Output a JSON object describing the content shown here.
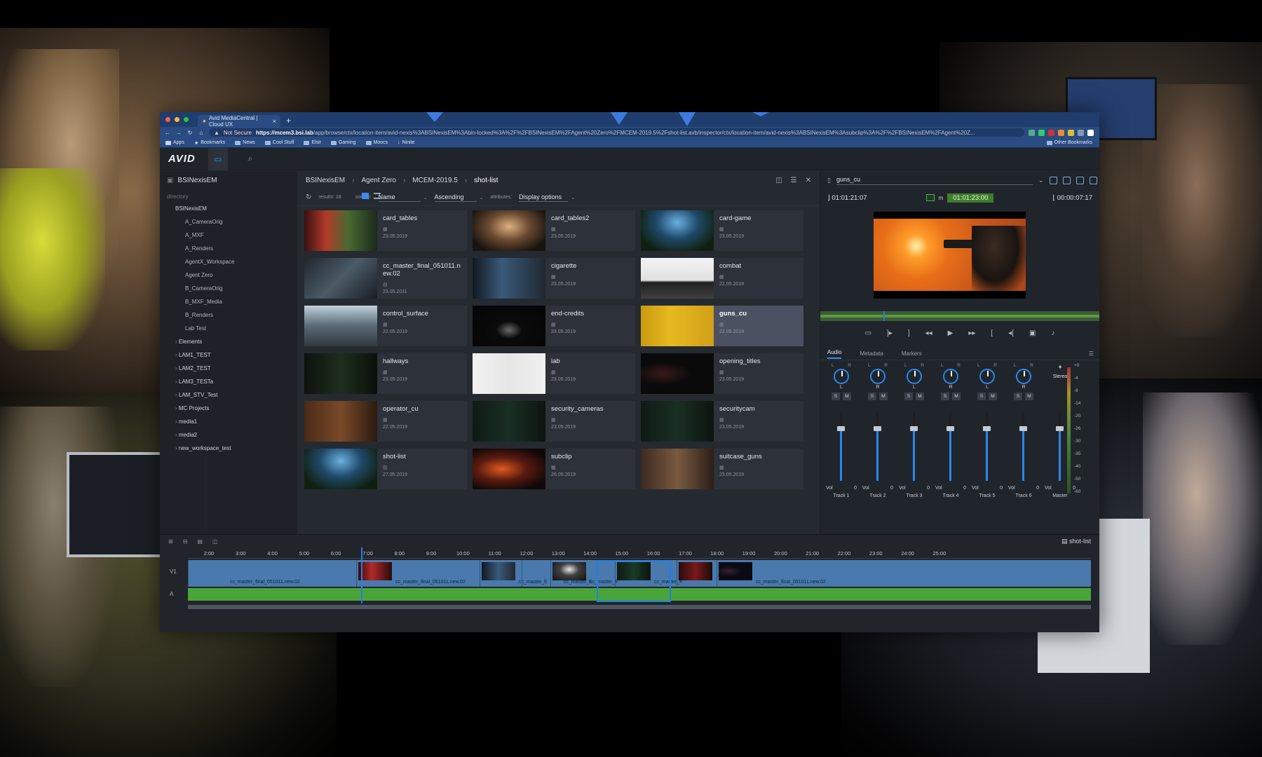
{
  "colors": {
    "accent": "#3a8df0",
    "browser_chrome": "#2a4c82",
    "timecode_green": "#3f7d2c",
    "clip_video": "#4a79ad",
    "clip_audio": "#49a43a",
    "selected_card": "#4b5161"
  },
  "browser": {
    "tab_title": "Avid MediaCentral | Cloud UX",
    "new_tab": "+",
    "not_secure": "Not Secure",
    "url_host": "https://mcem3.bsi.lab",
    "url_path": "/app/browse/ctx/location-item/avid-nexis%3ABSINexisEM%3Abin-locked%3A%2F%2FBSINexisEM%2FAgent%20Zero%2FMCEM-2019.5%2Fshot-list.avb/inspector/ctx/location-item/avid-nexis%3ABSINexisEM%3Asubclip%3A%2F%2FBSINexisEM%2FAgent%20Z...",
    "bookmarks": [
      "Apps",
      "Bookmarks",
      "News",
      "Cool Stuff",
      "Elsir",
      "Gaming",
      "Moocs",
      "Ninite"
    ],
    "other_bookmarks": "Other Bookmarks"
  },
  "app": {
    "logo": "AVID",
    "sidebar": {
      "root": "BSINexisEM",
      "label": "directory",
      "items_sub": [
        "BSINexisEM",
        "A_CameraOrig",
        "A_MXF",
        "A_Renders",
        "AgentX_Workspace",
        "Agent Zero",
        "B_CameraOrig",
        "B_MXF_Media",
        "B_Renders",
        "Lab Test"
      ],
      "items_top": [
        "Elements",
        "LAM1_TEST",
        "LAM2_TEST",
        "LAM3_TESTa",
        "LAM_STV_Test",
        "MC Projects",
        "media1",
        "media2",
        "new_workspace_test"
      ]
    },
    "browse": {
      "crumbs": [
        "BSINexisEM",
        "Agent Zero",
        "MCEM-2019.5",
        "shot-list"
      ],
      "results": "results: 18",
      "sort_label": "sort by:",
      "sort_value": "Name",
      "order_value": "Ascending",
      "attributes_label": "attributes:",
      "attributes_value": "Display options",
      "items": [
        {
          "name": "card_tables",
          "date": "23.05.2019",
          "icon": "clip-icon"
        },
        {
          "name": "card_tables2",
          "date": "23.05.2019",
          "icon": "clip-icon"
        },
        {
          "name": "card-game",
          "date": "23.05.2019",
          "icon": "clip-icon"
        },
        {
          "name": "cc_master_final_051011.new.02",
          "date": "23.05.2011",
          "icon": "sequence-icon"
        },
        {
          "name": "cigarette",
          "date": "23.05.2019",
          "icon": "clip-icon"
        },
        {
          "name": "combat",
          "date": "22.05.2019",
          "icon": "clip-icon"
        },
        {
          "name": "control_surface",
          "date": "22.05.2019",
          "icon": "clip-icon"
        },
        {
          "name": "end-credits",
          "date": "23.05.2019",
          "icon": "clip-icon"
        },
        {
          "name": "guns_cu",
          "date": "22.05.2019",
          "icon": "clip-icon"
        },
        {
          "name": "hallways",
          "date": "23.05.2019",
          "icon": "clip-icon"
        },
        {
          "name": "lab",
          "date": "23.05.2019",
          "icon": "clip-icon"
        },
        {
          "name": "opening_titles",
          "date": "23.05.2019",
          "icon": "clip-icon"
        },
        {
          "name": "operator_cu",
          "date": "22.05.2019",
          "icon": "clip-icon"
        },
        {
          "name": "security_cameras",
          "date": "23.05.2019",
          "icon": "clip-icon"
        },
        {
          "name": "securitycam",
          "date": "23.05.2019",
          "icon": "clip-icon"
        },
        {
          "name": "shot-list",
          "date": "27.05.2019",
          "icon": "bin-icon"
        },
        {
          "name": "subclip",
          "date": "26.05.2019",
          "icon": "clip-icon"
        },
        {
          "name": "suitcase_guns",
          "date": "23.05.2019",
          "icon": "clip-icon"
        }
      ],
      "selected": "guns_cu"
    },
    "inspector": {
      "asset": "guns_cu",
      "tc_in": "01:01:21:07",
      "tc_mode": "m",
      "tc_current": "01:01:23:00",
      "tc_duration": "00:00:07:17",
      "tabs": [
        "Audio",
        "Metadata",
        "Markers"
      ],
      "channels": [
        {
          "name": "Track 1",
          "pan": "L",
          "vol": "0"
        },
        {
          "name": "Track 2",
          "pan": "R",
          "vol": "0"
        },
        {
          "name": "Track 3",
          "pan": "L",
          "vol": "0"
        },
        {
          "name": "Track 4",
          "pan": "R",
          "vol": "0"
        },
        {
          "name": "Track 5",
          "pan": "L",
          "vol": "0"
        },
        {
          "name": "Track 6",
          "pan": "R",
          "vol": "0"
        }
      ],
      "master": {
        "name": "Master",
        "mode": "Stereo",
        "vol": "0"
      },
      "vol_label": "Vol",
      "meter_ticks": [
        "+0",
        "-4",
        "-8",
        "-14",
        "-20",
        "-26",
        "-30",
        "-35",
        "-40",
        "-50",
        "-60"
      ]
    },
    "timeline": {
      "sequence": "shot-list",
      "ruler": [
        "2:00",
        "3:00",
        "4:00",
        "5:00",
        "6:00",
        "7:00",
        "8:00",
        "9:00",
        "10:00",
        "11:00",
        "12:00",
        "13:00",
        "14:00",
        "15:00",
        "16:00",
        "17:00",
        "18:00",
        "19:00",
        "20:00",
        "21:00",
        "22:00",
        "23:00",
        "24:00",
        "25:00"
      ],
      "clip_label": "cc_master_final_051011.new.02",
      "clip_label_short": "cc_master_fi",
      "track_v": "V1",
      "track_a": "A"
    }
  }
}
